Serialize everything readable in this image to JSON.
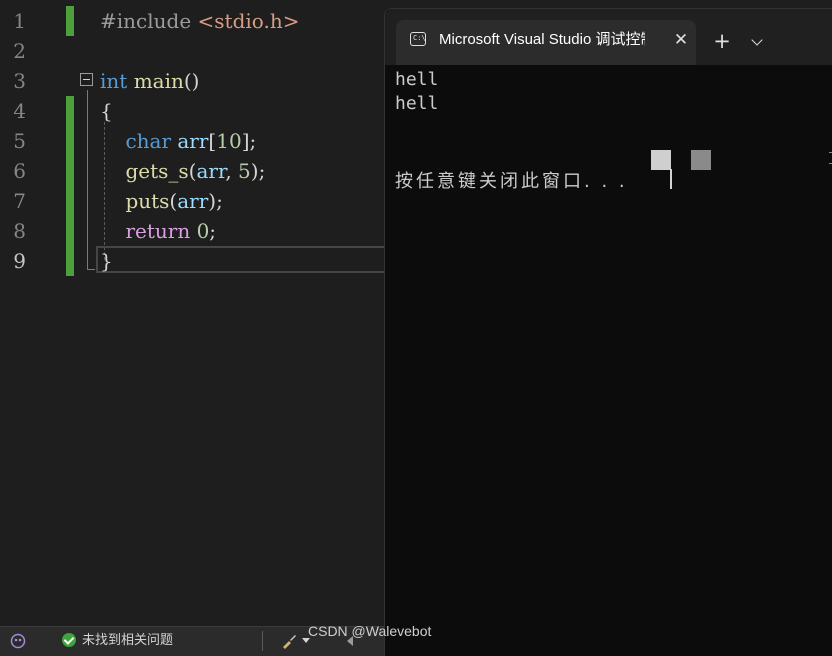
{
  "editor": {
    "line_numbers": [
      "1",
      "2",
      "3",
      "4",
      "5",
      "6",
      "7",
      "8",
      "9"
    ],
    "lines": [
      {
        "t1": "#include ",
        "t2": "<stdio.h>"
      },
      {},
      {
        "t1": "int",
        "t2": " ",
        "t3": "main",
        "t4": "()"
      },
      {
        "t1": "{"
      },
      {
        "t1": "    ",
        "t2": "char",
        "t3": " ",
        "t4": "arr",
        "t5": "[",
        "t6": "10",
        "t7": "];"
      },
      {
        "t1": "    ",
        "t2": "gets_s",
        "t3": "(",
        "t4": "arr",
        "t5": ", ",
        "t6": "5",
        "t7": ");"
      },
      {
        "t1": "    ",
        "t2": "puts",
        "t3": "(",
        "t4": "arr",
        "t5": ");"
      },
      {
        "t1": "    ",
        "t2": "return",
        "t3": " ",
        "t4": "0",
        "t5": ";"
      },
      {
        "t1": "}"
      }
    ]
  },
  "status": {
    "issues_text": "未找到相关问题",
    "copilot_icon": "copilot-icon",
    "brush_icon": "brush-icon"
  },
  "terminal": {
    "tab_title": "Microsoft Visual Studio 调试控制台",
    "close_glyph": "✕",
    "new_tab_glyph": "+",
    "output": [
      "hell",
      "hell"
    ],
    "prompt": "按任意键关闭此窗口. . ."
  },
  "watermark": "CSDN @Walevebot",
  "colors": {
    "keyword": "#569cd6",
    "function": "#dcdcaa",
    "variable": "#9cdcfe",
    "number": "#b5cea8",
    "control": "#d8a0df",
    "change_bar": "#4e9f3d"
  }
}
